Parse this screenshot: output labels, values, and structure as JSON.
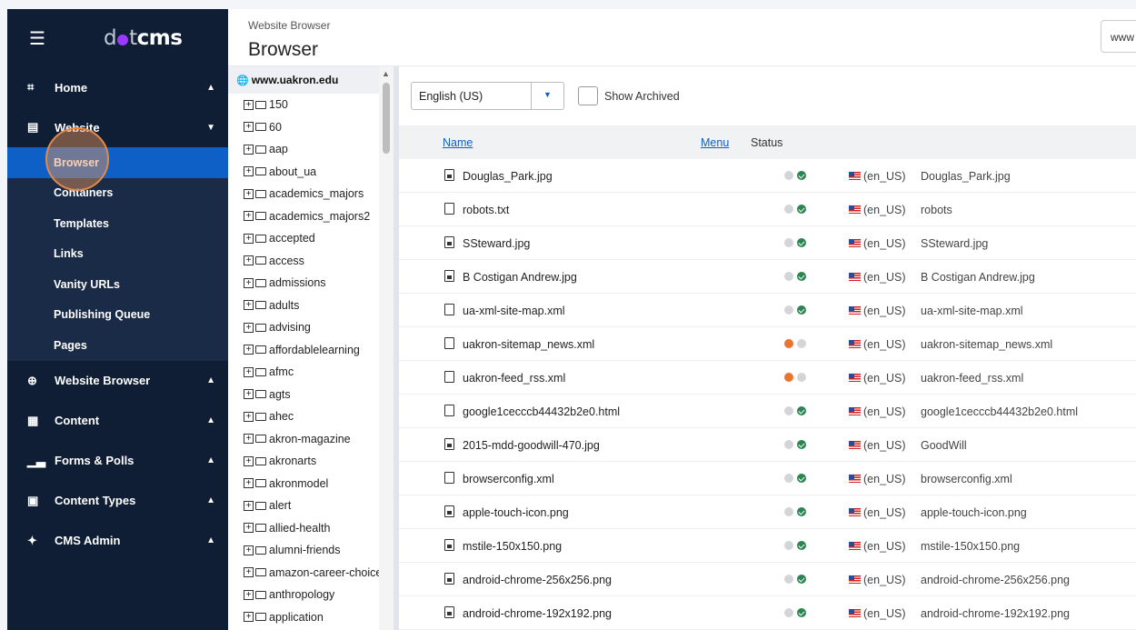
{
  "sidebar": {
    "logo": {
      "prefix": "d",
      "mid": "t",
      "suffix": "cms"
    },
    "groups": [
      {
        "label": "Home",
        "icon": "dashboard-icon",
        "expanded": false
      },
      {
        "label": "Website",
        "icon": "window-icon",
        "expanded": true,
        "items": [
          "Browser",
          "Containers",
          "Templates",
          "Links",
          "Vanity URLs",
          "Publishing Queue",
          "Pages"
        ],
        "active": "Browser"
      },
      {
        "label": "Website Browser",
        "icon": "globe-icon",
        "expanded": false
      },
      {
        "label": "Content",
        "icon": "grid-icon",
        "expanded": false
      },
      {
        "label": "Forms & Polls",
        "icon": "bar-chart-icon",
        "expanded": false
      },
      {
        "label": "Content Types",
        "icon": "blocks-icon",
        "expanded": false
      },
      {
        "label": "CMS Admin",
        "icon": "settings-icon",
        "expanded": false
      }
    ]
  },
  "header": {
    "breadcrumb": "Website Browser",
    "title": "Browser",
    "site_selector": "www"
  },
  "tree": {
    "root": "www.uakron.edu",
    "folders": [
      "150",
      "60",
      "aap",
      "about_ua",
      "academics_majors",
      "academics_majors2",
      "accepted",
      "access",
      "admissions",
      "adults",
      "advising",
      "affordablelearning",
      "afmc",
      "agts",
      "ahec",
      "akron-magazine",
      "akronarts",
      "akronmodel",
      "alert",
      "allied-health",
      "alumni-friends",
      "amazon-career-choice",
      "anthropology",
      "application"
    ]
  },
  "toolbar": {
    "language": "English (US)",
    "show_archived_label": "Show Archived",
    "show_archived": false
  },
  "table": {
    "columns": {
      "name": "Name",
      "menu": "Menu",
      "status": "Status"
    },
    "rows": [
      {
        "name": "Douglas_Park.jpg",
        "type": "image",
        "status": [
          "grey",
          "green"
        ],
        "locale": "(en_US)",
        "title": "Douglas_Park.jpg"
      },
      {
        "name": "robots.txt",
        "type": "file",
        "status": [
          "grey",
          "green"
        ],
        "locale": "(en_US)",
        "title": "robots"
      },
      {
        "name": "SSteward.jpg",
        "type": "image",
        "status": [
          "grey",
          "green"
        ],
        "locale": "(en_US)",
        "title": "SSteward.jpg"
      },
      {
        "name": "B Costigan Andrew.jpg",
        "type": "image",
        "status": [
          "grey",
          "green"
        ],
        "locale": "(en_US)",
        "title": "B Costigan Andrew.jpg"
      },
      {
        "name": "ua-xml-site-map.xml",
        "type": "file",
        "status": [
          "grey",
          "green"
        ],
        "locale": "(en_US)",
        "title": "ua-xml-site-map.xml"
      },
      {
        "name": "uakron-sitemap_news.xml",
        "type": "file",
        "status": [
          "orange",
          "grey"
        ],
        "locale": "(en_US)",
        "title": "uakron-sitemap_news.xml"
      },
      {
        "name": "uakron-feed_rss.xml",
        "type": "file",
        "status": [
          "orange",
          "grey"
        ],
        "locale": "(en_US)",
        "title": "uakron-feed_rss.xml"
      },
      {
        "name": "google1cecccb44432b2e0.html",
        "type": "file",
        "status": [
          "grey",
          "green"
        ],
        "locale": "(en_US)",
        "title": "google1cecccb44432b2e0.html"
      },
      {
        "name": "2015-mdd-goodwill-470.jpg",
        "type": "image",
        "status": [
          "grey",
          "green"
        ],
        "locale": "(en_US)",
        "title": "GoodWill"
      },
      {
        "name": "browserconfig.xml",
        "type": "file",
        "status": [
          "grey",
          "green"
        ],
        "locale": "(en_US)",
        "title": "browserconfig.xml"
      },
      {
        "name": "apple-touch-icon.png",
        "type": "image",
        "status": [
          "grey",
          "green"
        ],
        "locale": "(en_US)",
        "title": "apple-touch-icon.png"
      },
      {
        "name": "mstile-150x150.png",
        "type": "image",
        "status": [
          "grey",
          "green"
        ],
        "locale": "(en_US)",
        "title": "mstile-150x150.png"
      },
      {
        "name": "android-chrome-256x256.png",
        "type": "image",
        "status": [
          "grey",
          "green"
        ],
        "locale": "(en_US)",
        "title": "android-chrome-256x256.png"
      },
      {
        "name": "android-chrome-192x192.png",
        "type": "image",
        "status": [
          "grey",
          "green"
        ],
        "locale": "(en_US)",
        "title": "android-chrome-192x192.png"
      }
    ]
  },
  "colors": {
    "sidebar_bg": "#0f1e35",
    "active": "#0e5fc6",
    "ok": "#2b8552",
    "warn": "#e87430"
  }
}
